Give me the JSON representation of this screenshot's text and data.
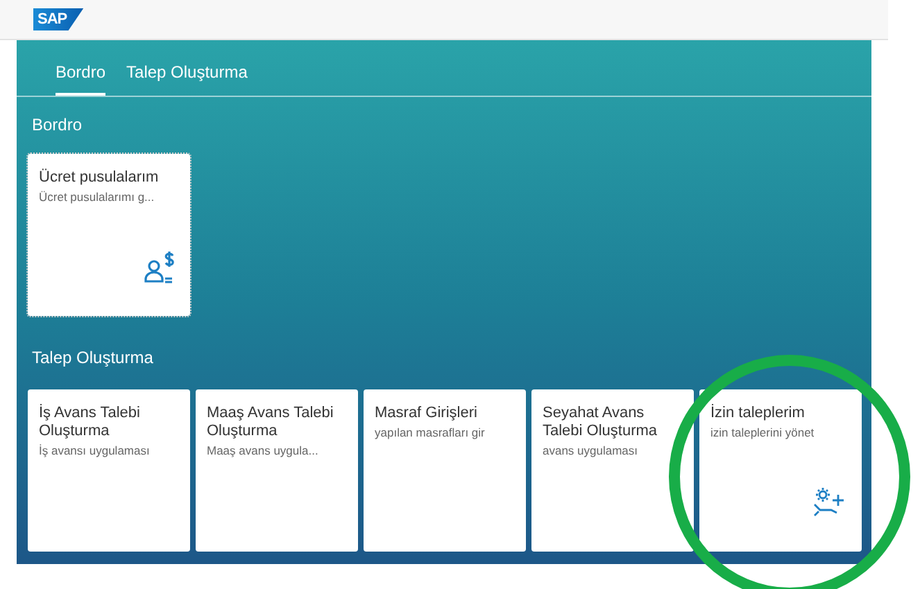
{
  "header": {
    "logo": "SAP"
  },
  "tabs": [
    {
      "label": "Bordro",
      "selected": true
    },
    {
      "label": "Talep Oluşturma",
      "selected": false
    }
  ],
  "groups": [
    {
      "title": "Bordro",
      "tiles": [
        {
          "title": "Ücret pusulalarım",
          "subtitle": "Ücret pusulalarımı g...",
          "kind": "payslip",
          "highlighted": false
        }
      ]
    },
    {
      "title": "Talep Oluşturma",
      "tiles": [
        {
          "title": "İş Avans Talebi Oluşturma",
          "subtitle": "İş avansı uygulaması",
          "highlighted": false
        },
        {
          "title": "Maaş Avans Talebi Oluşturma",
          "subtitle": "Maaş avans uygula...",
          "highlighted": false
        },
        {
          "title": "Masraf Girişleri",
          "subtitle": "yapılan masrafları gir",
          "highlighted": false
        },
        {
          "title": "Seyahat Avans Talebi Oluşturma",
          "subtitle": "avans uygulaması",
          "highlighted": false
        },
        {
          "title": "İzin taleplerim",
          "subtitle": "izin taleplerini yönet",
          "kind": "leave",
          "highlighted": true
        }
      ]
    }
  ]
}
